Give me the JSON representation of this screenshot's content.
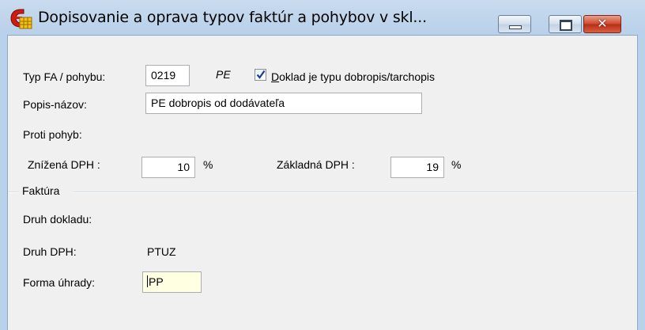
{
  "window": {
    "title": "Dopisovanie a oprava typov faktúr a pohybov v skl...",
    "icon": "app-icon",
    "minimize_icon": "minimize-icon",
    "maximize_icon": "maximize-icon",
    "close_icon": "close-icon",
    "close_glyph": "✕"
  },
  "form": {
    "typ_label": "Typ FA / pohybu:",
    "typ_value": "0219",
    "typ_code": "PE",
    "checkbox_accel": "D",
    "checkbox_label_rest": "oklad je typu dobropis/tarchopis",
    "checkbox_checked": true,
    "popis_label": "Popis-názov:",
    "popis_value": "PE dobropis od dodávateľa",
    "proti_pohyb_label": "Proti pohyb:",
    "znizena_label": "Znížená DPH :",
    "znizena_value": "10",
    "znizena_unit": "%",
    "zakladna_label": "Základná DPH :",
    "zakladna_value": "19",
    "zakladna_unit": "%"
  },
  "faktura": {
    "group_title": "Faktúra",
    "druh_dokladu_label": "Druh dokladu:",
    "druh_dph_label": "Druh DPH:",
    "druh_dph_value": "PTUZ",
    "forma_uhrady_label": "Forma úhrady:",
    "forma_uhrady_value": "PP"
  },
  "colors": {
    "titlebar": "#b9d1ea",
    "client": "#f0f0f0",
    "close_button": "#c9432b",
    "focused_input": "#ffffe1"
  }
}
